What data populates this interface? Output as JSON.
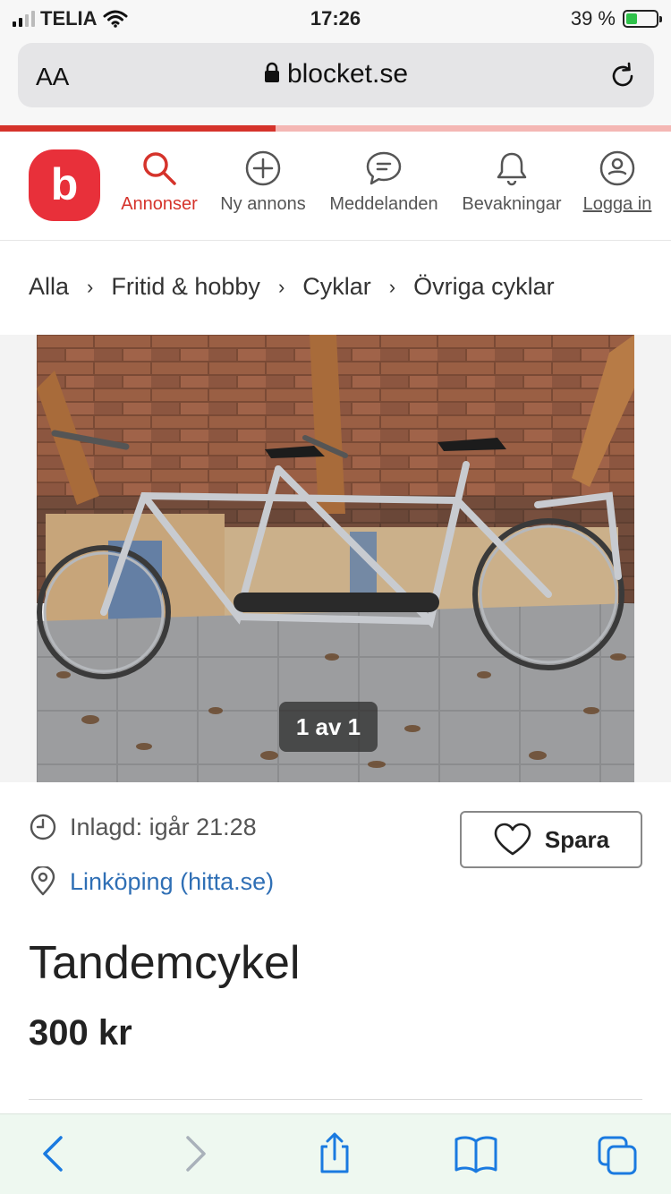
{
  "status": {
    "carrier": "TELIA",
    "time": "17:26",
    "battery": "39 %",
    "battery_level": 0.39
  },
  "browser": {
    "text_size": "AA",
    "url": "blocket.se"
  },
  "nav": {
    "logo_letter": "b",
    "items": [
      {
        "label": "Annonser",
        "icon": "search-icon",
        "active": true
      },
      {
        "label": "Ny annons",
        "icon": "plus-circle-icon"
      },
      {
        "label": "Meddelanden",
        "icon": "chat-icon"
      },
      {
        "label": "Bevakningar",
        "icon": "bell-icon"
      },
      {
        "label": "Logga in",
        "icon": "user-icon"
      }
    ]
  },
  "breadcrumb": [
    "Alla",
    "Fritid & hobby",
    "Cyklar",
    "Övriga cyklar"
  ],
  "gallery": {
    "counter": "1 av 1"
  },
  "listing": {
    "posted": "Inlagd: igår 21:28",
    "location": "Linköping (hitta.se)",
    "save_label": "Spara",
    "title": "Tandemcykel",
    "price": "300 kr"
  },
  "colors": {
    "brand": "#e8303a",
    "active": "#d5332b",
    "link": "#2f6fb5",
    "toolbar_icons": "#1a7ae0"
  }
}
